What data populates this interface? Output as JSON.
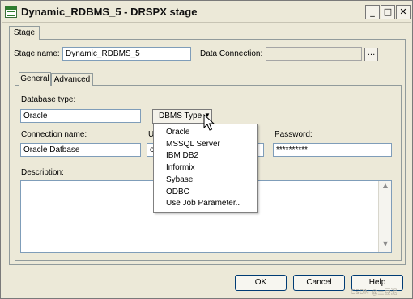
{
  "window": {
    "title": "Dynamic_RDBMS_5 - DRSPX stage",
    "controls": {
      "minimize": "_",
      "maximize": "□",
      "close": "✕"
    }
  },
  "tabs": {
    "stage": "Stage"
  },
  "stage": {
    "name_label": "Stage name:",
    "name_value": "Dynamic_RDBMS_5",
    "data_connection_label": "Data Connection:",
    "data_connection_value": "",
    "browse_label": "..."
  },
  "subtabs": {
    "general": "General",
    "advanced": "Advanced"
  },
  "general": {
    "db_type_label": "Database type:",
    "db_type_value": "Oracle",
    "dbms_button": "DBMS Type",
    "connection_label": "Connection name:",
    "connection_value": "Oracle Datbase",
    "user_label_partial": "U",
    "user_value_partial": "o",
    "password_label": "Password:",
    "password_value": "**********",
    "description_label": "Description:",
    "description_value": ""
  },
  "dbms_menu": {
    "items": [
      "Oracle",
      "MSSQL Server",
      "IBM DB2",
      "Informix",
      "Sybase",
      "ODBC",
      "Use Job Parameter..."
    ]
  },
  "buttons": {
    "ok": "OK",
    "cancel": "Cancel",
    "help": "Help"
  },
  "watermark": "CSDN @土豆泥",
  "icons": {
    "app": "stage-grid-icon",
    "cursor": "mouse-pointer-icon",
    "scroll_up": "scroll-up-arrow-icon",
    "scroll_down": "scroll-down-arrow-icon",
    "dropdown": "dropdown-caret-icon"
  }
}
